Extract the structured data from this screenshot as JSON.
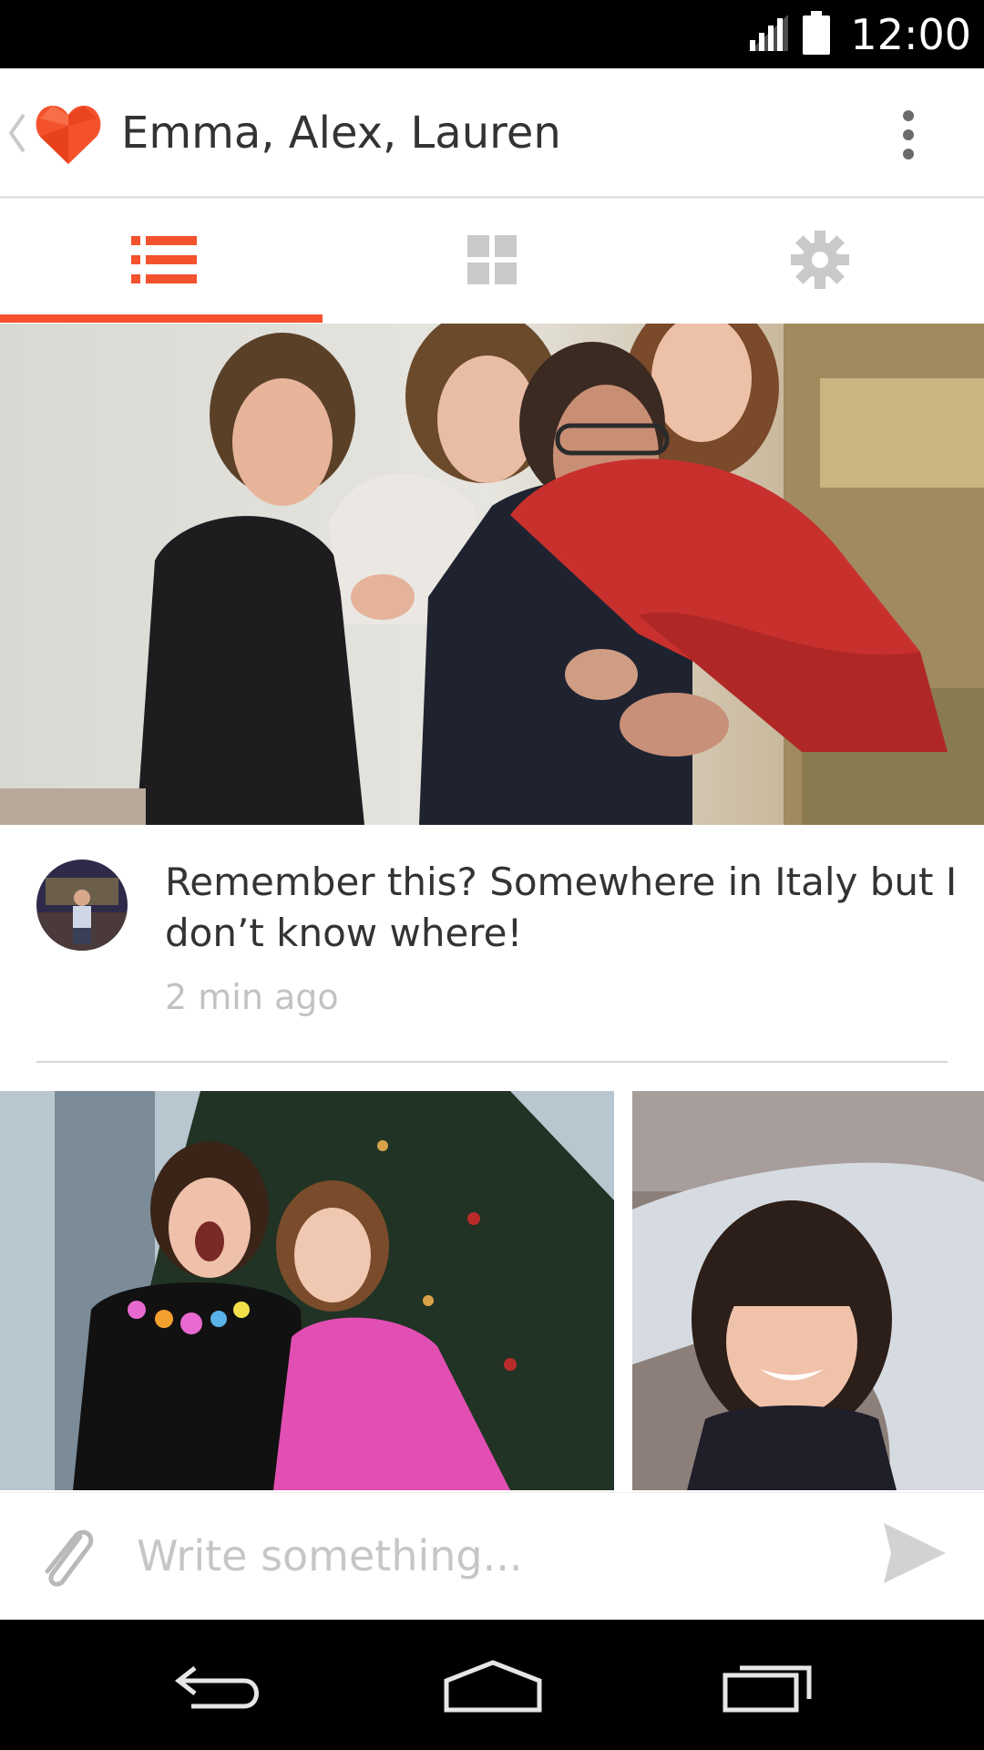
{
  "status_bar": {
    "time": "12:00",
    "icons": [
      "signal-icon",
      "battery-icon"
    ]
  },
  "header": {
    "title": "Emma, Alex, Lauren",
    "icons": [
      "back-chevron-icon",
      "heart-logo-icon",
      "overflow-menu-icon"
    ]
  },
  "tabs": [
    {
      "icon": "list-icon",
      "selected": true
    },
    {
      "icon": "grid-icon",
      "selected": false
    },
    {
      "icon": "settings-gear-icon",
      "selected": false
    }
  ],
  "message": {
    "text": "Remember this? Somewhere in Italy but I don’t know where!",
    "time": "2 min ago"
  },
  "composer": {
    "placeholder": "Write something...",
    "icons": [
      "paperclip-icon",
      "send-icon"
    ]
  },
  "nav_bar": {
    "icons": [
      "back-icon",
      "home-icon",
      "recents-icon"
    ]
  },
  "colors": {
    "accent": "#f4522d",
    "inactive_icon": "#c9c9c9",
    "title_text": "#333333",
    "timestamp": "#c2c2c2"
  }
}
